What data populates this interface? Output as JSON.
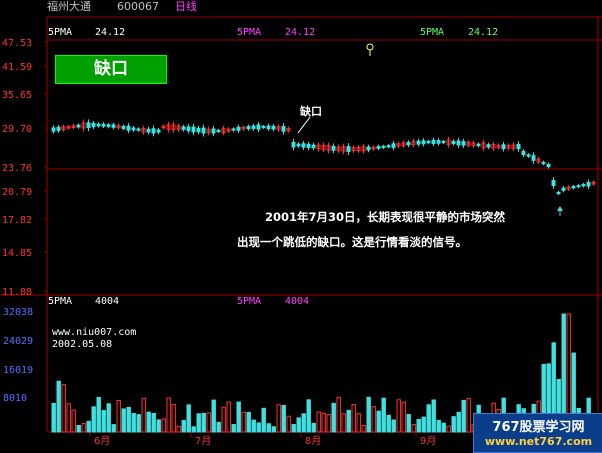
{
  "header": {
    "stock_name": "福州大通",
    "stock_code": "600067",
    "period": "日线"
  },
  "price_panel": {
    "ma_label": "5PMA",
    "ma_value": "24.12",
    "y_ticks": [
      "47.53",
      "41.59",
      "35.65",
      "29.70",
      "23.76",
      "20.79",
      "17.82",
      "14.85",
      "11.88"
    ],
    "gap_badge": "缺口",
    "gap_callout": "缺口",
    "note_line1": "2001年7月30日，长期表现很平静的市场突然",
    "note_line2": "出现一个跳低的缺口。这是行情看淡的信号。"
  },
  "volume_panel": {
    "ma_label": "5PMA",
    "ma_value": "4004",
    "y_ticks": [
      "32038",
      "24029",
      "16019",
      "8010"
    ],
    "website": "www.niu007.com",
    "date": "2002.05.08"
  },
  "x_axis": {
    "month_labels": [
      "6月",
      "7月",
      "8月",
      "9月"
    ]
  },
  "watermark": {
    "title": "767股票学习网",
    "url": "www.net767.com"
  },
  "colors": {
    "up": "#ff3030",
    "down": "#40e0e0",
    "grid": "#a00000",
    "ma_white": "#ffffff",
    "ma_magenta": "#ff40ff",
    "ma_green": "#60ff60",
    "axis_text_red": "#ff3030",
    "axis_text_blue": "#5070ff"
  }
}
